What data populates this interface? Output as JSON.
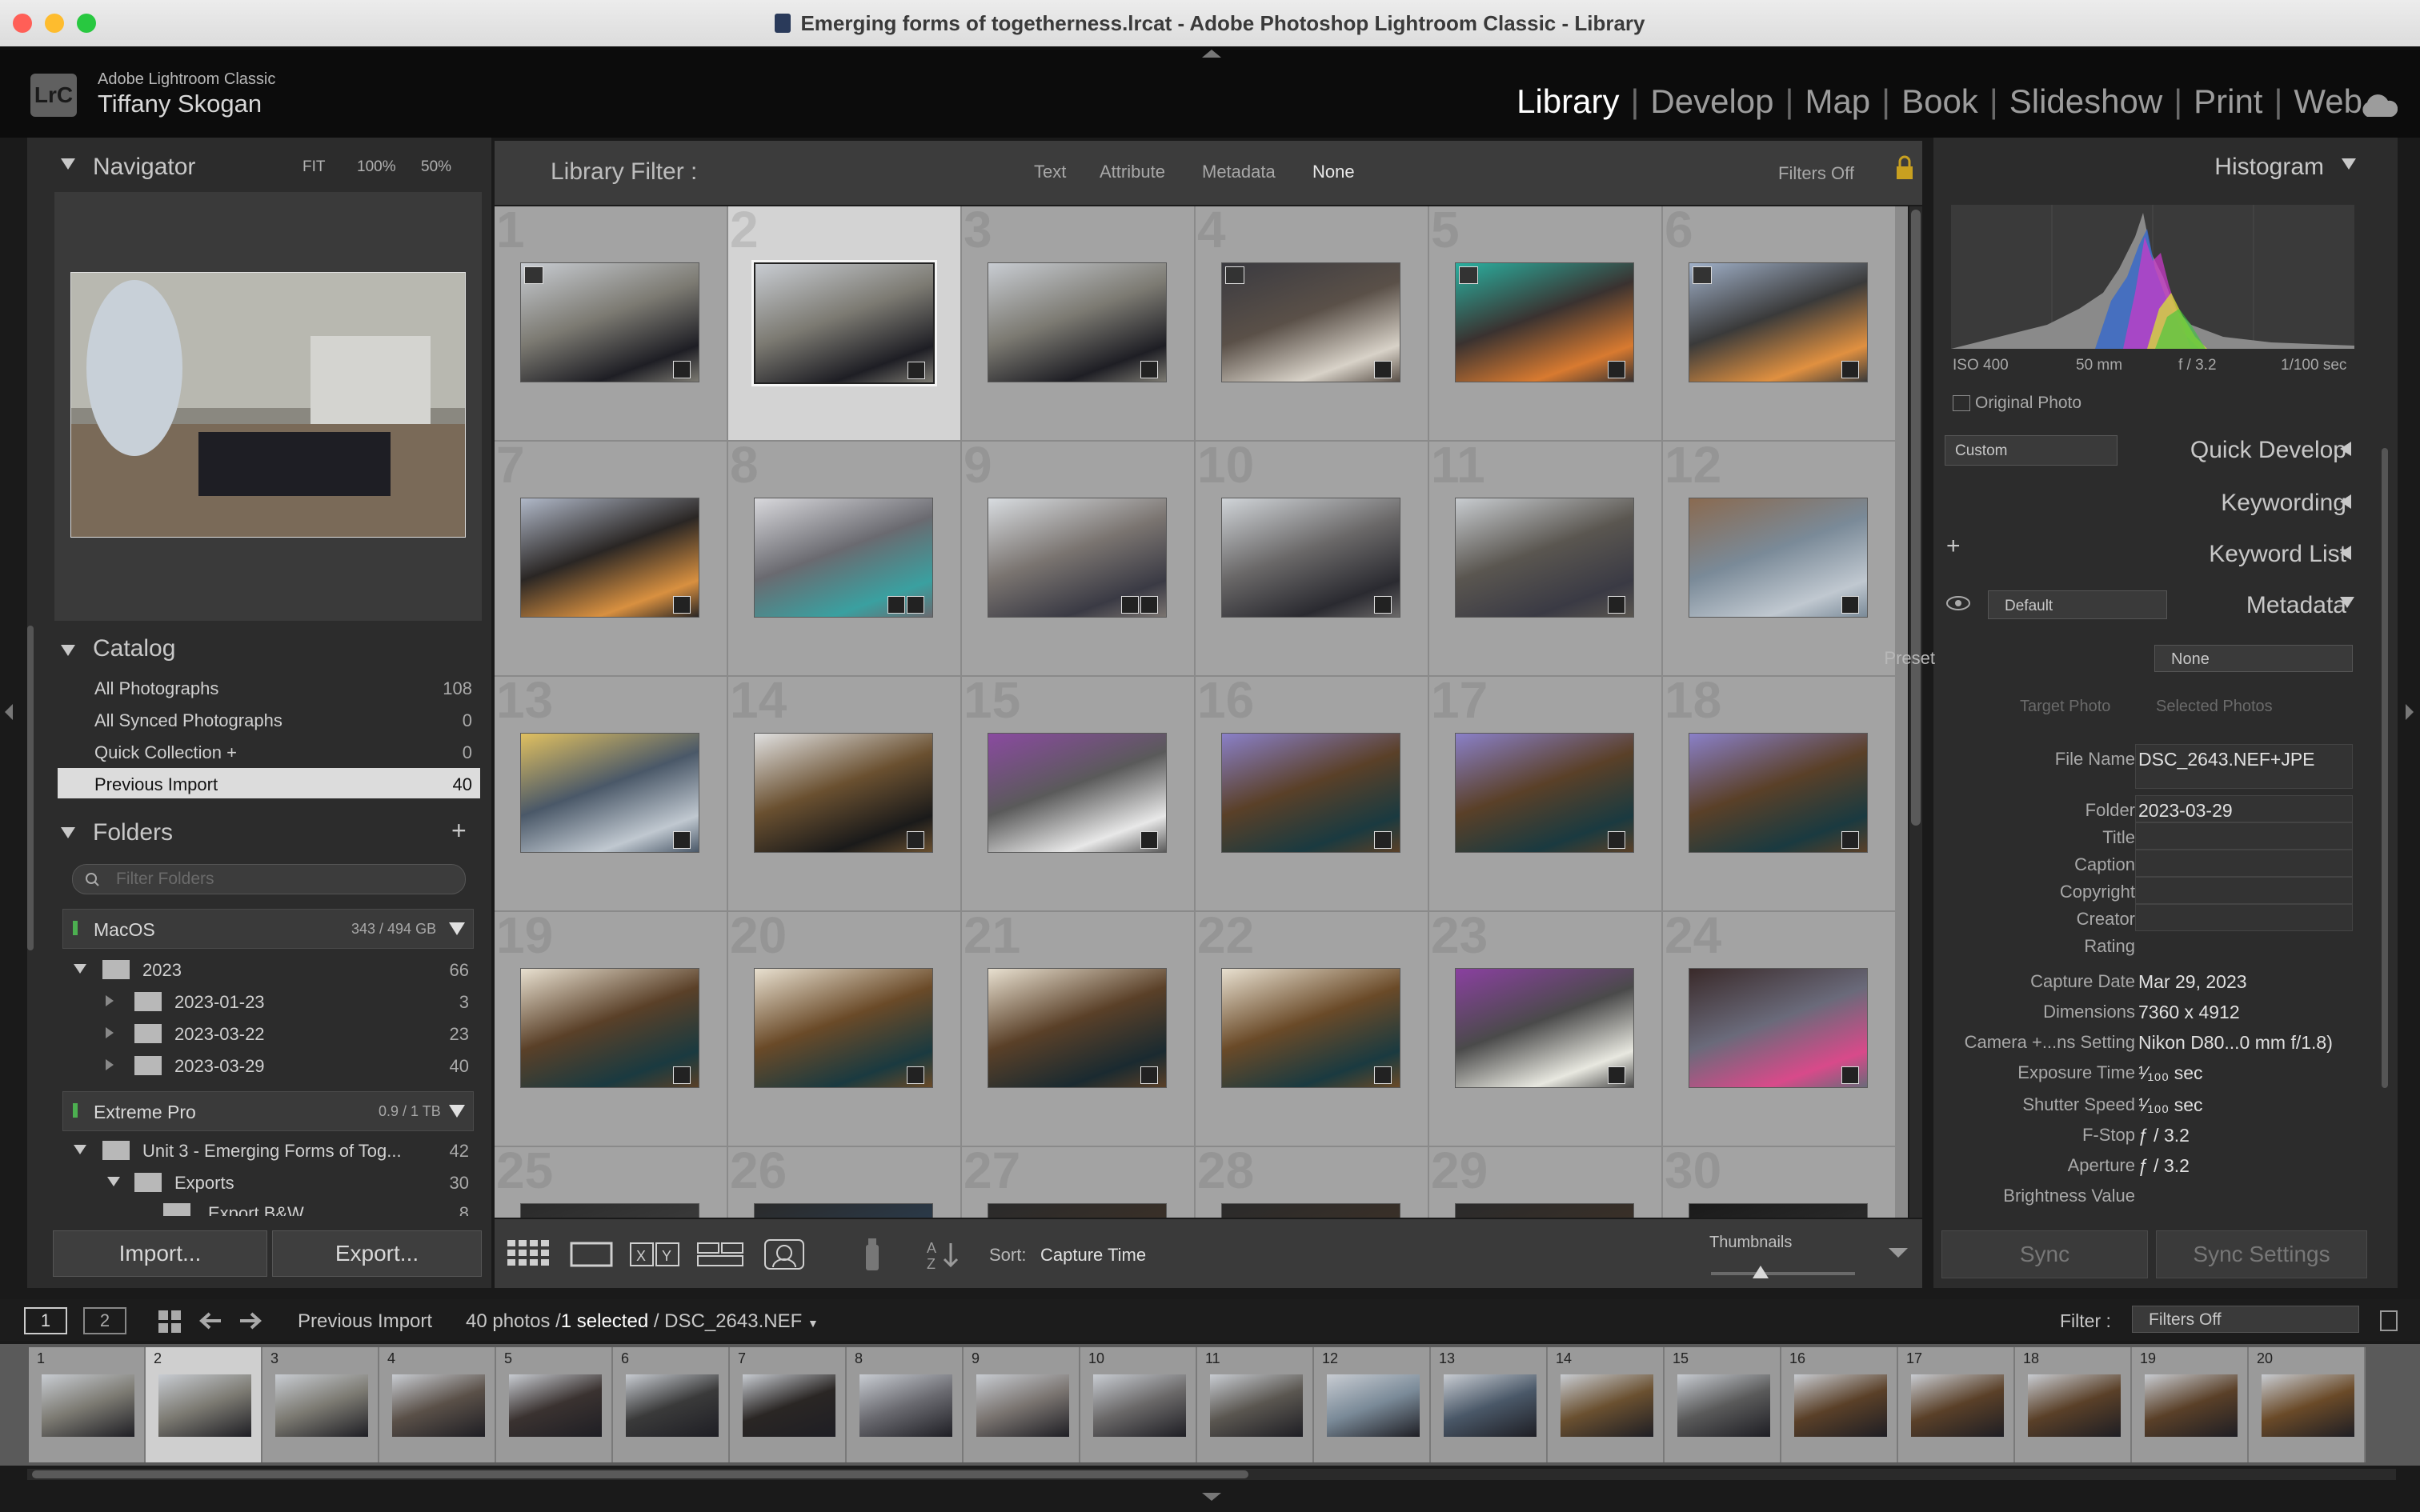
{
  "window": {
    "title": "Emerging forms of togetherness.lrcat - Adobe Photoshop Lightroom Classic - Library"
  },
  "identity": {
    "logo": "LrC",
    "app_name": "Adobe Lightroom Classic",
    "user_name": "Tiffany Skogan"
  },
  "modules": [
    "Library",
    "Develop",
    "Map",
    "Book",
    "Slideshow",
    "Print",
    "Web"
  ],
  "active_module": "Library",
  "navigator": {
    "title": "Navigator",
    "zoom_options": [
      "FIT",
      "100%",
      "50%"
    ]
  },
  "catalog": {
    "title": "Catalog",
    "items": [
      {
        "label": "All Photographs",
        "count": "108"
      },
      {
        "label": "All Synced Photographs",
        "count": "0"
      },
      {
        "label": "Quick Collection +",
        "count": "0"
      },
      {
        "label": "Previous Import",
        "count": "40"
      }
    ]
  },
  "folders": {
    "title": "Folders",
    "filter_placeholder": "Filter Folders",
    "volumes": [
      {
        "name": "MacOS",
        "usage": "343 / 494 GB"
      },
      {
        "name": "Extreme Pro",
        "usage": "0.9 / 1 TB"
      }
    ],
    "tree": [
      {
        "label": "2023",
        "count": "66"
      },
      {
        "label": "2023-01-23",
        "count": "3"
      },
      {
        "label": "2023-03-22",
        "count": "23"
      },
      {
        "label": "2023-03-29",
        "count": "40"
      },
      {
        "label": "Unit 3 - Emerging Forms of Tog...",
        "count": "42"
      },
      {
        "label": "Exports",
        "count": "30"
      },
      {
        "label": "Export B&W",
        "count": "8"
      }
    ]
  },
  "left_buttons": {
    "import": "Import...",
    "export": "Export..."
  },
  "filter_bar": {
    "label": "Library Filter :",
    "options": [
      "Text",
      "Attribute",
      "Metadata",
      "None"
    ],
    "status": "Filters Off"
  },
  "grid": {
    "cells": [
      "1",
      "2",
      "3",
      "4",
      "5",
      "6",
      "7",
      "8",
      "9",
      "10",
      "11",
      "12",
      "13",
      "14",
      "15",
      "16",
      "17",
      "18",
      "19",
      "20",
      "21",
      "22",
      "23",
      "24",
      "25",
      "26",
      "27",
      "28",
      "29",
      "30"
    ],
    "selected": "2"
  },
  "toolbar": {
    "sort_label": "Sort:",
    "sort_value": "Capture Time",
    "thumbnails_label": "Thumbnails"
  },
  "histogram": {
    "title": "Histogram",
    "iso": "ISO 400",
    "focal": "50 mm",
    "fstop": "f / 3.2",
    "shutter": "1/100 sec",
    "original_photo": "Original Photo"
  },
  "right_panels": {
    "quick_develop": "Quick Develop",
    "qd_preset": "Custom",
    "keywording": "Keywording",
    "keyword_list": "Keyword List",
    "metadata": "Metadata",
    "metadata_preset": "Default",
    "preset_label": "Preset",
    "preset_value": "None",
    "target_photo": "Target Photo",
    "selected_photos": "Selected Photos"
  },
  "metadata": [
    {
      "label": "File Name",
      "value": "DSC_2643.NEF+JPE"
    },
    {
      "label": "Folder",
      "value": "2023-03-29"
    },
    {
      "label": "Title",
      "value": ""
    },
    {
      "label": "Caption",
      "value": ""
    },
    {
      "label": "Copyright",
      "value": ""
    },
    {
      "label": "Creator",
      "value": ""
    },
    {
      "label": "Rating",
      "value": ""
    },
    {
      "label": "Capture Date",
      "value": "Mar 29, 2023"
    },
    {
      "label": "Dimensions",
      "value": "7360 x 4912"
    },
    {
      "label": "Camera +...ns Setting",
      "value": "Nikon D80...0 mm f/1.8)"
    },
    {
      "label": "Exposure Time",
      "value": "¹⁄₁₀₀ sec"
    },
    {
      "label": "Shutter Speed",
      "value": "¹⁄₁₀₀ sec"
    },
    {
      "label": "F-Stop",
      "value": "ƒ / 3.2"
    },
    {
      "label": "Aperture",
      "value": "ƒ / 3.2"
    },
    {
      "label": "Brightness Value",
      "value": ""
    }
  ],
  "sync": {
    "sync": "Sync",
    "sync_settings": "Sync Settings"
  },
  "filmstrip": {
    "screens": [
      "1",
      "2"
    ],
    "source": "Previous Import",
    "status": "40 photos /",
    "selected": "1 selected",
    "path": "/ DSC_2643.NEF",
    "filter_label": "Filter :",
    "filter_value": "Filters Off",
    "numbers": [
      "1",
      "2",
      "3",
      "4",
      "5",
      "6",
      "7",
      "8",
      "9",
      "10",
      "11",
      "12",
      "13",
      "14",
      "15",
      "16",
      "17",
      "18",
      "19",
      "20"
    ]
  }
}
